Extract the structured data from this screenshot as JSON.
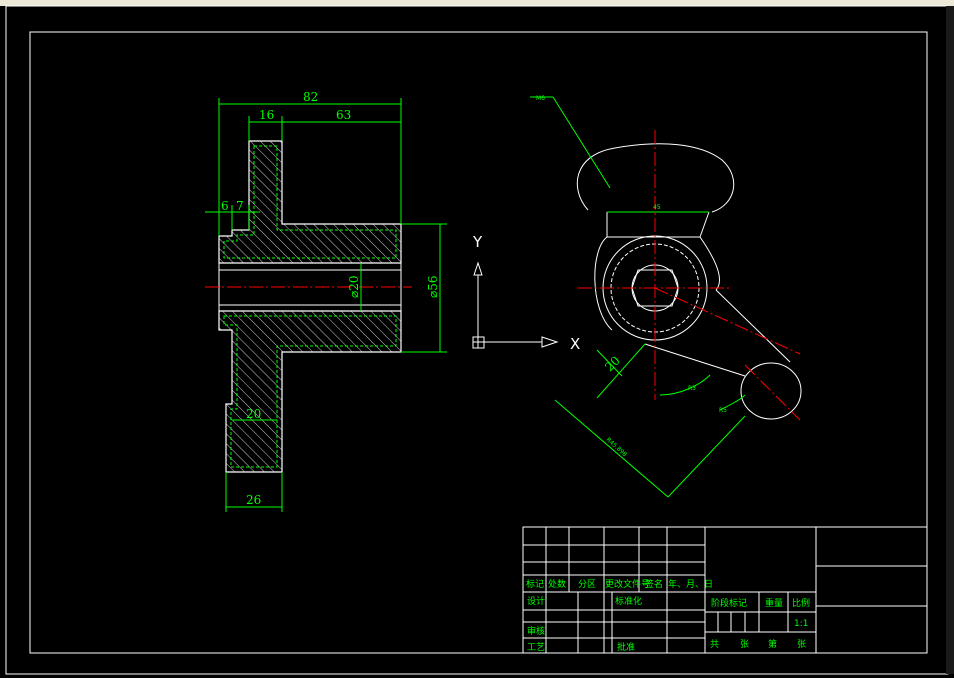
{
  "dimensions": {
    "overall_length": "82",
    "flange_width": "16",
    "hub_length": "63",
    "step_a": "6",
    "step_b": "7",
    "bore_diameter": "⌀20",
    "outer_diameter": "⌀56",
    "slot_inner_width": "20",
    "slot_outer_width": "26",
    "side_view_width": "45",
    "arm_offset": "20",
    "arm_radius": "R3",
    "arm_length": "R45.898",
    "angle": "R5",
    "leader_note": "M6"
  },
  "ucs_icon": {
    "x_label": "X",
    "y_label": "Y"
  },
  "title_block": {
    "revision_headers": [
      "标记",
      "处数",
      "分区",
      "更改文件号",
      "签名",
      "年、月、日"
    ],
    "designer_label": "设计",
    "standardization_label": "标准化",
    "reviewer_label": "审核",
    "process_label": "工艺",
    "approve_label": "批准",
    "stage_mark_label": "阶段标记",
    "weight_label": "重量",
    "scale_label": "比例",
    "scale_value": "1:1",
    "total_label": "共",
    "sheets_label": "张",
    "sheet_no_label": "第",
    "sheet_label": "张"
  },
  "colors": {
    "background": "#000000",
    "geometry": "#ffffff",
    "dimension": "#00ff00",
    "centerline": "#ff0000"
  }
}
